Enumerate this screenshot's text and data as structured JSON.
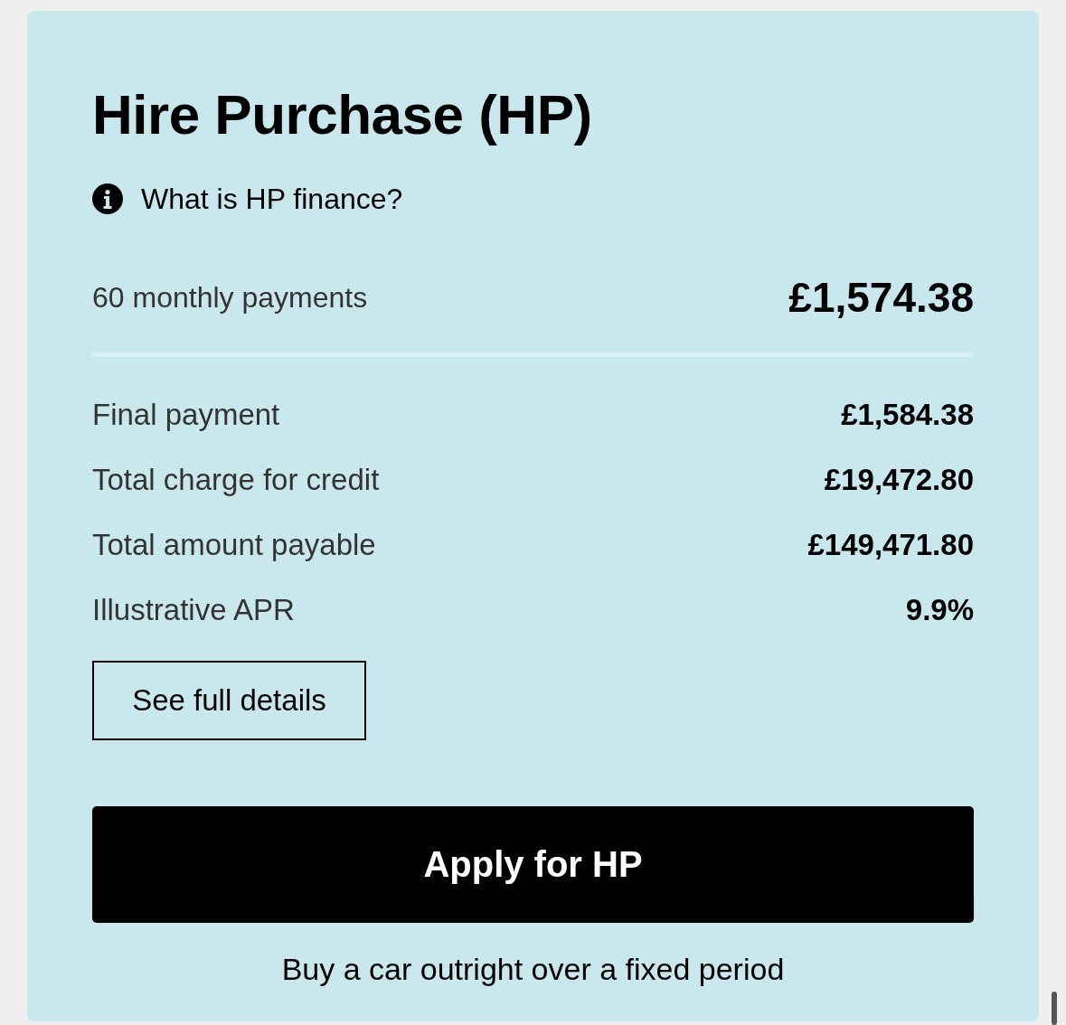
{
  "card": {
    "title": "Hire Purchase (HP)",
    "info_link": "What is HP finance?",
    "monthly": {
      "label": "60 monthly payments",
      "value": "£1,574.38"
    },
    "rows": [
      {
        "label": "Final payment",
        "value": "£1,584.38"
      },
      {
        "label": "Total charge for credit",
        "value": "£19,472.80"
      },
      {
        "label": "Total amount payable",
        "value": "£149,471.80"
      },
      {
        "label": "Illustrative APR",
        "value": "9.9%"
      }
    ],
    "details_button": "See full details",
    "apply_button": "Apply for HP",
    "footnote": "Buy a car outright over a fixed period"
  }
}
